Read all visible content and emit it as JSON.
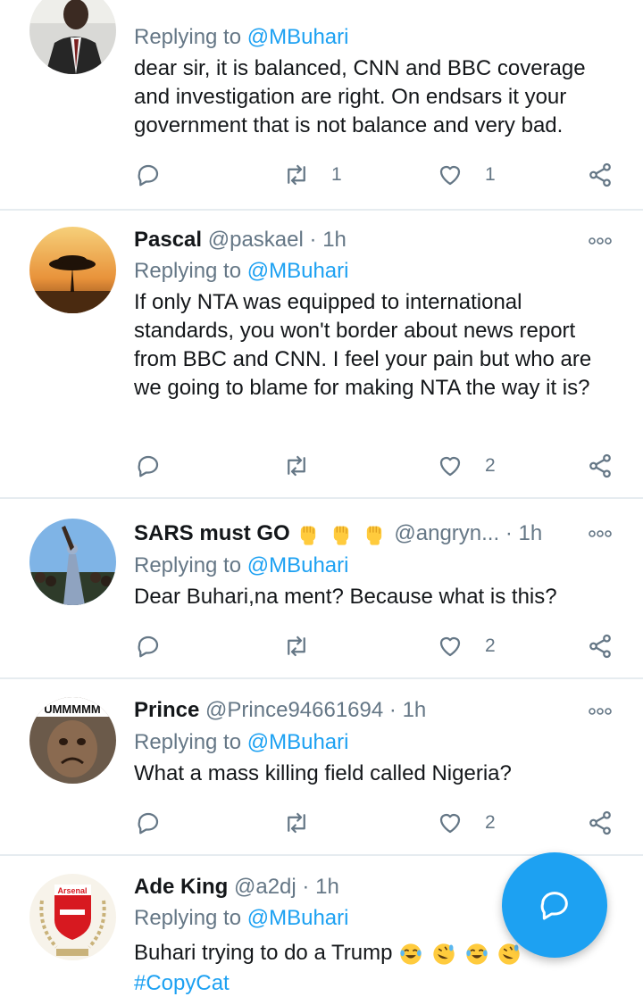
{
  "colors": {
    "accent": "#1da1f2",
    "secondary_text": "#657786",
    "divider": "#e6ecf0"
  },
  "tweets": [
    {
      "replying_prefix": "Replying to",
      "replying_to": "@MBuhari",
      "text": "dear sir, it is balanced, CNN and BBC coverage and investigation are right. On endsars it your government that is not balance and very bad.",
      "retweets": "1",
      "likes": "1"
    },
    {
      "name": "Pascal",
      "handle": "@paskael",
      "dot": "·",
      "time": "1h",
      "replying_prefix": "Replying to",
      "replying_to": "@MBuhari",
      "text": "If only NTA was equipped to international standards,  you won't border about news report from BBC and CNN. I feel your pain but who are we going to blame for making NTA the way it is?",
      "retweets": "",
      "likes": "2"
    },
    {
      "name": "SARS must GO",
      "name_emoji": [
        "raised-fist",
        "raised-fist",
        "raised-fist"
      ],
      "handle": "@angryn...",
      "dot": "·",
      "time": "1h",
      "replying_prefix": "Replying to",
      "replying_to": "@MBuhari",
      "text": "Dear Buhari,na ment? Because what is this?",
      "retweets": "",
      "likes": "2"
    },
    {
      "name": "Prince",
      "handle": "@Prince94661694",
      "dot": "·",
      "time": "1h",
      "avatar_text": "UMMMMM",
      "replying_prefix": "Replying to",
      "replying_to": "@MBuhari",
      "text": "What a mass killing field called Nigeria?",
      "retweets": "",
      "likes": "2"
    },
    {
      "name": "Ade King",
      "handle": "@a2dj",
      "dot": "·",
      "time": "1h",
      "avatar_text": "Arsenal",
      "replying_prefix": "Replying to",
      "replying_to": "@MBuhari",
      "text": "Buhari trying to do a Trump",
      "text_emoji": [
        "joy",
        "rofl",
        "joy",
        "rofl"
      ],
      "hashtag": "#CopyCat"
    }
  ],
  "icons": {
    "reply": "reply-icon",
    "retweet": "retweet-icon",
    "like": "heart-icon",
    "share": "share-icon",
    "more": "more-icon",
    "compose": "compose-reply-icon"
  }
}
